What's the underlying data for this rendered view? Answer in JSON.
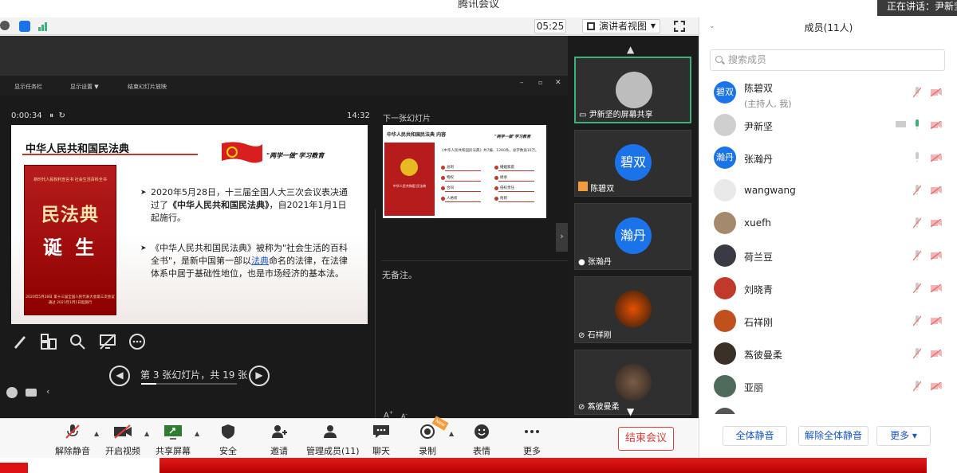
{
  "window": {
    "title": "腾讯会议",
    "speaking": "正在讲话：尹新坚"
  },
  "topbar": {
    "timer": "05:25",
    "view_mode": "演讲者视图"
  },
  "presentation": {
    "elapsed": "0:00:34",
    "clock": "14:32",
    "next_label": "下一张幻灯片",
    "ppt_menu": [
      "显示任务栏",
      "显示设置 ▼",
      "结束幻灯片放映"
    ],
    "slide": {
      "title": "中华人民共和国民法典",
      "slogan": "\"两学一做\"学习教育",
      "book_top": "新时代人民权利宣言书 社会生活百科全书",
      "book_title": "民法典",
      "book_sub": "诞 生",
      "book_bottom": "2020年5月28日 第十三届全国人民代表大会第三次会议通过 2021年1月1日起施行",
      "bullet1_a": "2020年5月28日，十三届全国人大三次会议表决通过了",
      "bullet1_b": "《中华人民共和国民法典》",
      "bullet1_c": "，自2021年1月1日起施行。",
      "bullet2_a": "《中华人民共和国民法典》被称为\"社会生活的百科全书\"，是新中国第一部以",
      "bullet2_link": "法典",
      "bullet2_b": "命名的法律，在法律体系中居于基础性地位，也是市场经济的基本法。"
    },
    "next_slide": {
      "title": "中华人民共和国民法典 内容",
      "slogan": "\"两学一做\"学习教育",
      "book_label": "中华人民共和国 民法典",
      "text": "《中华人民共和国民法典》共7编、1260条，总字数逾10万。",
      "items": [
        "总则",
        "物权",
        "合同",
        "人格权",
        "婚姻家庭",
        "继承",
        "侵权责任",
        "附则"
      ]
    },
    "notes": "无备注。",
    "slide_counter": "第 3 张幻灯片，共 19 张",
    "progress": 0.16
  },
  "videos": [
    {
      "name": "尹新坚的屏幕共享",
      "avatar": ""
    },
    {
      "name": "陈碧双",
      "avatar": "碧双"
    },
    {
      "name": "张瀚丹",
      "avatar": "瀚丹"
    },
    {
      "name": "石祥刚",
      "avatar": ""
    },
    {
      "name": "蒍彼曼柔",
      "avatar": ""
    }
  ],
  "panel": {
    "header": "成员(11人)",
    "search_placeholder": "搜索成员",
    "members": [
      {
        "name": "陈碧双",
        "sub": "(主持人, 我)",
        "avatar": "碧双",
        "color": "#1a73e8"
      },
      {
        "name": "尹新坚",
        "sub": "",
        "avatar": "",
        "color": "#cfcfcf"
      },
      {
        "name": "张瀚丹",
        "sub": "",
        "avatar": "瀚丹",
        "color": "#1a73e8"
      },
      {
        "name": "wangwang",
        "sub": "",
        "avatar": "",
        "color": "#e9e9e9"
      },
      {
        "name": "xuefh",
        "sub": "",
        "avatar": "",
        "color": "#a48a6a"
      },
      {
        "name": "荷兰豆",
        "sub": "",
        "avatar": "",
        "color": "#3a3a44"
      },
      {
        "name": "刘晓青",
        "sub": "",
        "avatar": "",
        "color": "#c0392b"
      },
      {
        "name": "石祥刚",
        "sub": "",
        "avatar": "",
        "color": "#c0501d"
      },
      {
        "name": "蒍彼曼柔",
        "sub": "",
        "avatar": "",
        "color": "#3b3027"
      },
      {
        "name": "亚丽",
        "sub": "",
        "avatar": "",
        "color": "#4d6a5b"
      }
    ],
    "mute_all": "全体静音",
    "unmute_all": "解除全体静音",
    "more": "更多 ▾"
  },
  "toolbar": {
    "unmute": "解除静音",
    "video": "开启视频",
    "share": "共享屏幕",
    "security": "安全",
    "invite": "邀请",
    "manage": "管理成员(11)",
    "chat": "聊天",
    "record": "录制",
    "emoji": "表情",
    "more": "更多",
    "end": "结束会议",
    "new_badge": "New"
  }
}
